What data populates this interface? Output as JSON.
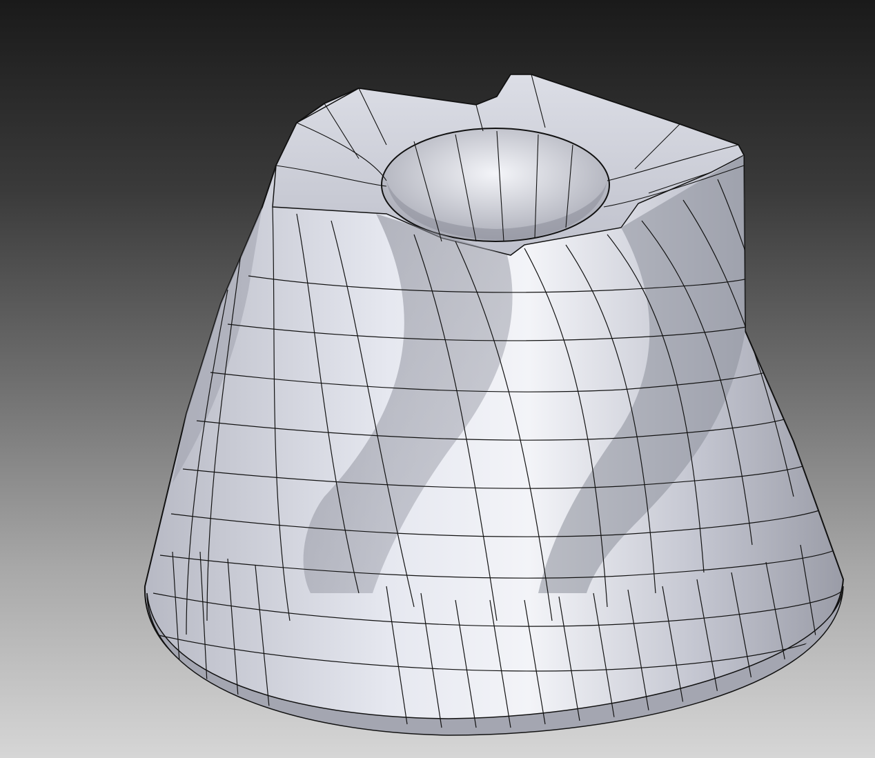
{
  "viewport": {
    "background_top": "#1a1a1a",
    "background_bottom": "#d6d6d6"
  },
  "model": {
    "kind": "3d-mesh-part",
    "surface_color": "#c9cbd6",
    "highlight_color": "#eef0f6",
    "shadow_color": "#8c8e99",
    "edge_color": "#111111",
    "display_mode": "shaded-with-edges"
  }
}
